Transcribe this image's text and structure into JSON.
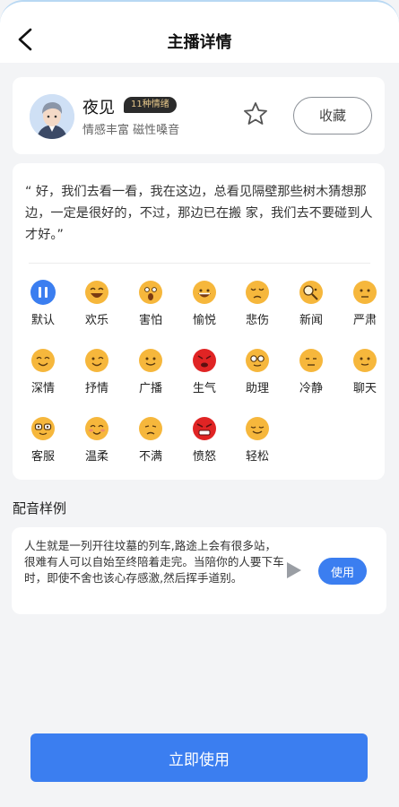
{
  "header": {
    "title": "主播详情"
  },
  "anchor": {
    "name": "夜见",
    "badge": "11种情绪",
    "tags": "情感丰富 磁性嗓音",
    "collect_label": "收藏"
  },
  "quote": "“ 好，我们去看一看，我在这边，总看见隔壁那些树木猜想那边，一定是很好的，不过，那边已在搬 家，我们去不要碰到人才好。”",
  "emotions": [
    {
      "label": "默认",
      "icon": "pause-icon"
    },
    {
      "label": "欢乐",
      "icon": "laughing-face-icon"
    },
    {
      "label": "害怕",
      "icon": "scared-face-icon"
    },
    {
      "label": "愉悦",
      "icon": "grinning-face-icon"
    },
    {
      "label": "悲伤",
      "icon": "sad-face-icon"
    },
    {
      "label": "新闻",
      "icon": "magnifier-face-icon"
    },
    {
      "label": "严肃",
      "icon": "serious-face-icon"
    },
    {
      "label": "深情",
      "icon": "smiling-face-icon"
    },
    {
      "label": "抒情",
      "icon": "winking-face-icon"
    },
    {
      "label": "广播",
      "icon": "slight-smile-face-icon"
    },
    {
      "label": "生气",
      "icon": "angry-red-face-icon"
    },
    {
      "label": "助理",
      "icon": "glasses-face-icon"
    },
    {
      "label": "冷静",
      "icon": "expressionless-face-icon"
    },
    {
      "label": "聊天",
      "icon": "neutral-smile-face-icon"
    },
    {
      "label": "客服",
      "icon": "nerd-face-icon"
    },
    {
      "label": "温柔",
      "icon": "blushing-face-icon"
    },
    {
      "label": "不满",
      "icon": "unamused-face-icon"
    },
    {
      "label": "愤怒",
      "icon": "furious-red-face-icon"
    },
    {
      "label": "轻松",
      "icon": "relieved-face-icon"
    }
  ],
  "sample": {
    "section_title": "配音样例",
    "text": "人生就是一列开往坟墓的列车,路途上会有很多站，很难有人可以自始至终陪着走完。当陪你的人要下车时，即使不舍也该心存感激,然后挥手道别。",
    "use_label": "使用"
  },
  "bottom": {
    "use_now_label": "立即使用"
  },
  "colors": {
    "accent": "#3b7ef0",
    "emoji_yellow": "#f6b73c",
    "emoji_red": "#e02424"
  }
}
